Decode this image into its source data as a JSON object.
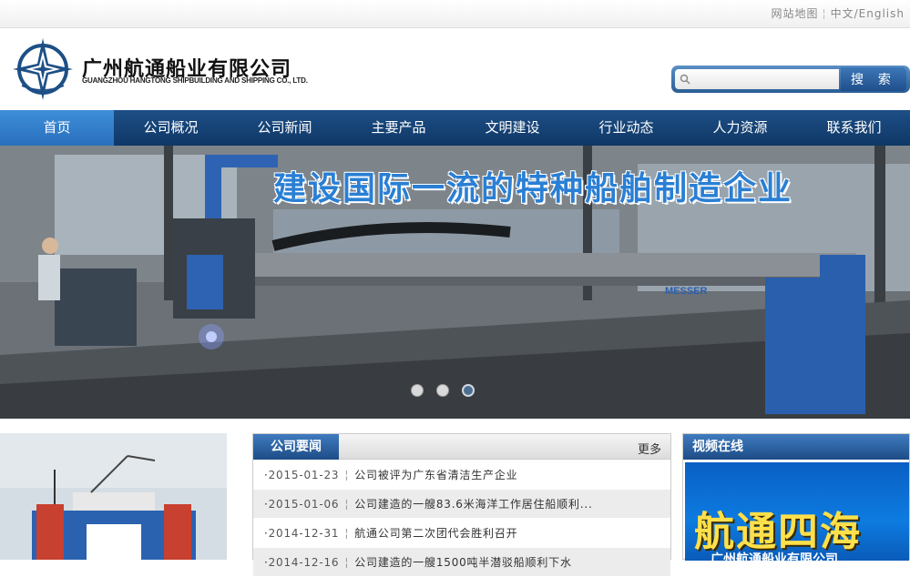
{
  "topbar": {
    "sitemap": "网站地图",
    "chinese": "中文",
    "english": "English"
  },
  "header": {
    "company_cn": "广州航通船业有限公司",
    "company_en": "GUANGZHOU HANGTONG SHIPBUILDING AND SHIPPING CO., LTD."
  },
  "search": {
    "placeholder": "",
    "button_label": "搜 索"
  },
  "nav": {
    "items": [
      "首页",
      "公司概况",
      "公司新闻",
      "主要产品",
      "文明建设",
      "行业动态",
      "人力资源",
      "联系我们"
    ],
    "active_index": 0
  },
  "banner": {
    "title": "建设国际一流的特种船舶制造企业",
    "machine_brand": "MESSER",
    "slide_count": 3,
    "active_slide": 3
  },
  "news": {
    "title": "公司要闻",
    "more": "更多",
    "items": [
      {
        "date": "2015-01-23",
        "text": "公司被评为广东省清洁生产企业"
      },
      {
        "date": "2015-01-06",
        "text": "公司建造的一艘83.6米海洋工作居住船顺利..."
      },
      {
        "date": "2014-12-31",
        "text": "航通公司第二次团代会胜利召开"
      },
      {
        "date": "2014-12-16",
        "text": "公司建造的一艘1500吨半潜驳船顺利下水"
      }
    ]
  },
  "video": {
    "title": "视频在线",
    "thumb_text": "航通四海",
    "thumb_sub": "广州航通船业有限公司"
  },
  "colors": {
    "nav": "#1d4f86",
    "nav_active": "#3d8ed8",
    "accent": "#2a7fd4",
    "video_bg": "#0d7be0"
  }
}
